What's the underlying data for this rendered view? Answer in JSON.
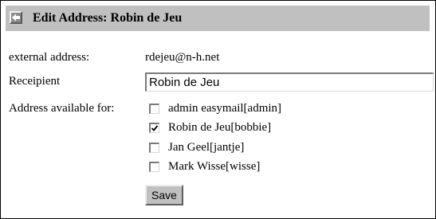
{
  "header": {
    "title": "Edit Address: Robin de Jeu",
    "back_icon": "back-arrow-icon"
  },
  "form": {
    "external_address": {
      "label": "external address:",
      "value": "rdejeu@n-h.net"
    },
    "recipient": {
      "label": "Receipient",
      "value": "Robin de Jeu"
    },
    "available_for": {
      "label": "Address available for:",
      "options": [
        {
          "label": "admin easymail[admin]",
          "checked": false
        },
        {
          "label": "Robin de Jeu[bobbie]",
          "checked": true
        },
        {
          "label": "Jan Geel[jantje]",
          "checked": false
        },
        {
          "label": "Mark Wisse[wisse]",
          "checked": false
        }
      ]
    },
    "save_label": "Save"
  },
  "colors": {
    "header_background": "#c0c0c0",
    "button_background": "#c0c0c0",
    "border": "#000000"
  }
}
